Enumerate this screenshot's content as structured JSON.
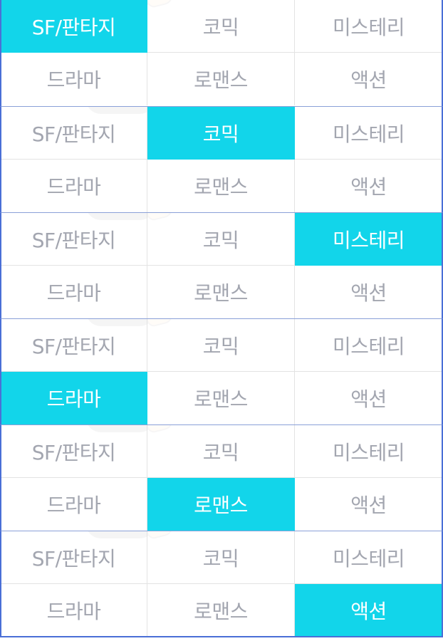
{
  "genres": [
    "SF/판타지",
    "코믹",
    "미스테리",
    "드라마",
    "로맨스",
    "액션"
  ],
  "panels": [
    {
      "active": "SF/판타지",
      "labels": [
        "SF/판타지",
        "코믹",
        "미스테리",
        "드라마",
        "로맨스",
        "액션"
      ]
    },
    {
      "active": "코믹",
      "labels": [
        "SF/판타지",
        "코믹",
        "미스테리",
        "드라마",
        "로맨스",
        "액션"
      ]
    },
    {
      "active": "미스테리",
      "labels": [
        "SF/판타지",
        "코믹",
        "미스테리",
        "드라마",
        "로맨스",
        "액션"
      ]
    },
    {
      "active": "드라마",
      "labels": [
        "SF/판타지",
        "코믹",
        "미스테리",
        "드라마",
        "로맨스",
        "액션"
      ]
    },
    {
      "active": "로맨스",
      "labels": [
        "SF/판타지",
        "코믹",
        "미스테리",
        "드라마",
        "로맨스",
        "액션"
      ]
    },
    {
      "active": "액션",
      "labels": [
        "SF/판타지",
        "코믹",
        "미스테리",
        "드라마",
        "로맨스",
        "액션"
      ]
    }
  ],
  "colors": {
    "active_bg": "#12d5ea",
    "active_text": "#ffffff",
    "inactive_text": "#a3a6b0",
    "border": "#4a6fd6"
  }
}
